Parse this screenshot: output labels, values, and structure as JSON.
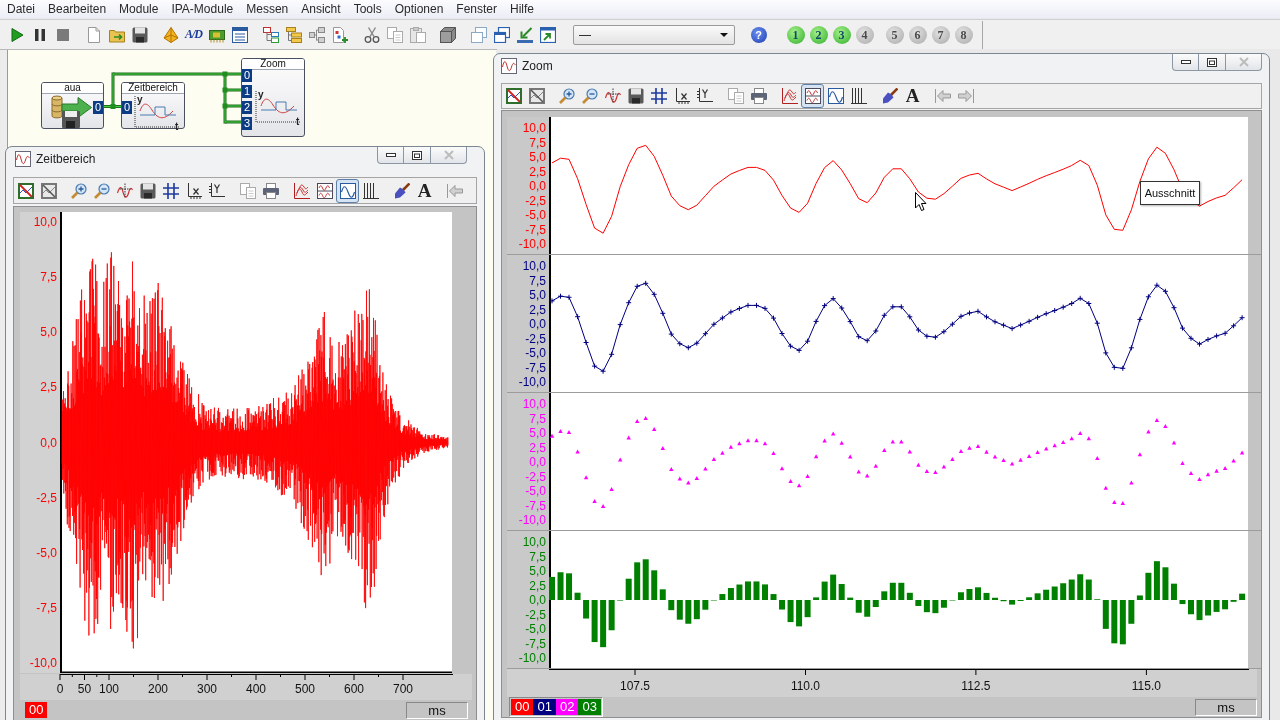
{
  "menu": [
    "Datei",
    "Bearbeiten",
    "Module",
    "IPA-Module",
    "Messen",
    "Ansicht",
    "Tools",
    "Optionen",
    "Fenster",
    "Hilfe"
  ],
  "toolbar": {
    "converter_button": "A/D",
    "dropdown": {
      "value": "—"
    },
    "help_button": "?",
    "channel_buttons": [
      {
        "label": "1",
        "on": true
      },
      {
        "label": "2",
        "on": true
      },
      {
        "label": "3",
        "on": true
      },
      {
        "label": "4",
        "on": false
      },
      {
        "label": "5",
        "on": false
      },
      {
        "label": "6",
        "on": false
      },
      {
        "label": "7",
        "on": false
      },
      {
        "label": "8",
        "on": false
      }
    ]
  },
  "flow_diagram": {
    "blocks": [
      {
        "kind": "source",
        "title": "aua",
        "ports": [
          "0"
        ]
      },
      {
        "kind": "display",
        "title": "Zeitbereich",
        "ports": [
          "0"
        ],
        "axis_labels": [
          "y",
          "t"
        ]
      },
      {
        "kind": "display",
        "title": "Zoom",
        "ports": [
          "0",
          "1",
          "2",
          "3"
        ],
        "axis_labels": [
          "y",
          "t"
        ]
      }
    ]
  },
  "windows": [
    {
      "title": "Zeitbereich",
      "text_tool": "A",
      "view_modes": [
        {
          "selected": false
        },
        {
          "selected": false
        },
        {
          "selected": true
        }
      ],
      "plots": [
        {
          "kind": "dense",
          "yticks": [
            "10,0",
            "7,5",
            "5,0",
            "2,5",
            "0,0",
            "-2,5",
            "-5,0",
            "-7,5",
            "-10,0"
          ]
        }
      ],
      "xticks": [
        "0",
        "50",
        "100",
        "200",
        "300",
        "400",
        "500",
        "600",
        "700"
      ],
      "channels": [
        {
          "label": "00",
          "color": "#ff0000"
        }
      ],
      "unit": "ms"
    },
    {
      "title": "Zoom",
      "text_tool": "A",
      "view_modes": [
        {
          "selected": false
        },
        {
          "selected": true
        },
        {
          "selected": false
        }
      ],
      "plots": [
        {
          "kind": "line",
          "yticks": [
            "10,0",
            "7,5",
            "5,0",
            "2,5",
            "0,0",
            "-2,5",
            "-5,0",
            "-7,5",
            "-10,0"
          ]
        },
        {
          "kind": "line_markers",
          "yticks": [
            "10,0",
            "7,5",
            "5,0",
            "2,5",
            "0,0",
            "-2,5",
            "-5,0",
            "-7,5",
            "-10,0"
          ]
        },
        {
          "kind": "markers",
          "yticks": [
            "10,0",
            "7,5",
            "5,0",
            "2,5",
            "0,0",
            "-2,5",
            "-5,0",
            "-7,5",
            "-10,0"
          ]
        },
        {
          "kind": "bars",
          "yticks": [
            "10,0",
            "7,5",
            "5,0",
            "2,5",
            "0,0",
            "-2,5",
            "-5,0",
            "-7,5",
            "-10,0"
          ]
        }
      ],
      "xticks": [
        "107.5",
        "110.0",
        "112.5",
        "115.0"
      ],
      "channels": [
        {
          "label": "00",
          "color": "#ff0000"
        },
        {
          "label": "01",
          "color": "#000080"
        },
        {
          "label": "02",
          "color": "#ff00ff"
        },
        {
          "label": "03",
          "color": "#008000"
        }
      ],
      "unit": "ms",
      "tooltip": "Ausschnitt"
    }
  ]
}
